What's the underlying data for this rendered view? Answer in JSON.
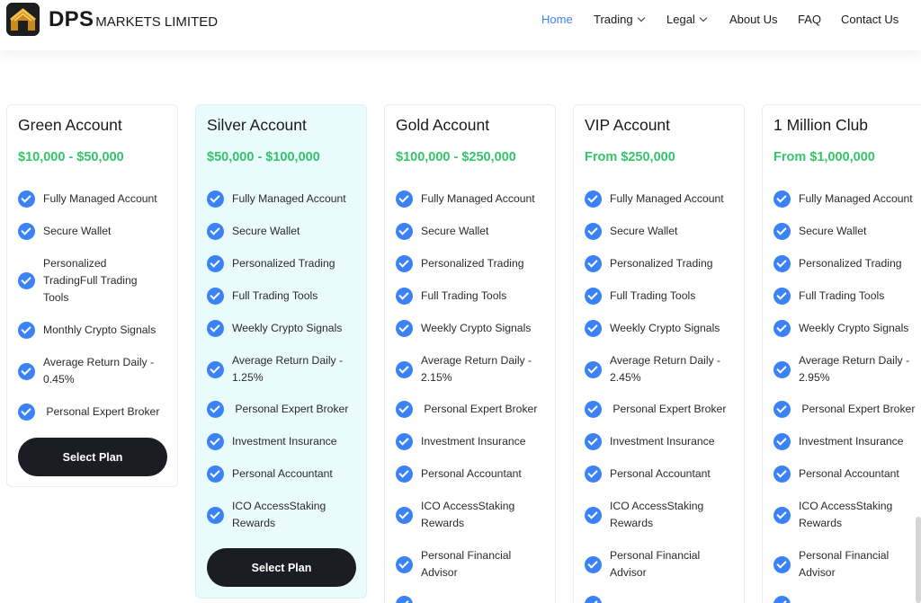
{
  "header": {
    "brand_main": "DPS",
    "brand_rest": "MARKETS LIMITED",
    "nav": [
      {
        "label": "Home",
        "active": true
      },
      {
        "label": "Trading",
        "dropdown": true
      },
      {
        "label": "Legal",
        "dropdown": true
      },
      {
        "label": "About Us"
      },
      {
        "label": "FAQ"
      },
      {
        "label": "Contact Us"
      }
    ]
  },
  "plans": [
    {
      "title": "Green Account",
      "price": "$10,000 - $50,000",
      "features": [
        "Fully Managed Account",
        "Secure Wallet",
        "Personalized TradingFull Trading Tools",
        "Monthly Crypto Signals",
        "Average Return Daily - 0.45%",
        " Personal Expert Broker"
      ],
      "button": "Select Plan"
    },
    {
      "title": "Silver Account",
      "price": "$50,000 - $100,000",
      "features": [
        "Fully Managed Account",
        "Secure Wallet",
        "Personalized Trading",
        "Full Trading Tools",
        "Weekly Crypto Signals",
        "Average Return Daily - 1.25%",
        " Personal Expert Broker",
        "Investment Insurance",
        "Personal Accountant",
        "ICO AccessStaking Rewards"
      ],
      "button": "Select Plan"
    },
    {
      "title": "Gold Account",
      "price": "$100,000 - $250,000",
      "features": [
        "Fully Managed Account",
        "Secure Wallet",
        "Personalized Trading",
        "Full Trading Tools",
        "Weekly Crypto Signals",
        "Average Return Daily - 2.15%",
        " Personal Expert Broker",
        "Investment Insurance",
        "Personal Accountant",
        "ICO AccessStaking Rewards",
        "Personal Financial Advisor"
      ]
    },
    {
      "title": "VIP Account",
      "price": "From $250,000",
      "features": [
        "Fully Managed Account",
        "Secure Wallet",
        "Personalized Trading",
        "Full Trading Tools",
        "Weekly Crypto Signals",
        "Average Return Daily - 2.45%",
        " Personal Expert Broker",
        "Investment Insurance",
        "Personal Accountant",
        "ICO AccessStaking Rewards",
        "Personal Financial Advisor"
      ]
    },
    {
      "title": "1 Million Club",
      "price": "From $1,000,000",
      "features": [
        "Fully Managed Account",
        "Secure Wallet",
        "Personalized Trading",
        "Full Trading Tools",
        "Weekly Crypto Signals",
        "Average Return Daily - 2.95%",
        " Personal Expert Broker",
        "Investment Insurance",
        "Personal Accountant",
        "ICO AccessStaking Rewards",
        "Personal Financial Advisor"
      ]
    }
  ],
  "colors": {
    "accent_blue": "#3b82f6",
    "price_green": "#34c56b",
    "button_dark": "#1c1d24",
    "silver_bg": "#e9fbfd"
  },
  "icons": {
    "logo": "dps-house-logo-icon",
    "feature": "check-circle-icon",
    "dropdown": "chevron-down-icon"
  }
}
